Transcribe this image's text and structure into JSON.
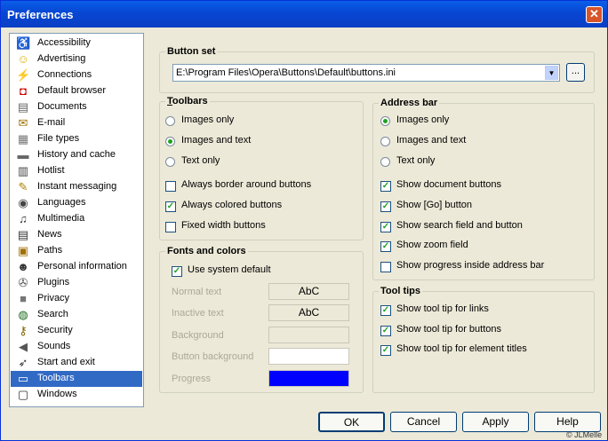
{
  "window": {
    "title": "Preferences",
    "close_glyph": "✕"
  },
  "categories": [
    {
      "label": "Accessibility",
      "icon": "accessibility-icon"
    },
    {
      "label": "Advertising",
      "icon": "smiley-icon"
    },
    {
      "label": "Connections",
      "icon": "plug-icon"
    },
    {
      "label": "Default browser",
      "icon": "default-browser-icon"
    },
    {
      "label": "Documents",
      "icon": "document-icon"
    },
    {
      "label": "E-mail",
      "icon": "envelope-icon"
    },
    {
      "label": "File types",
      "icon": "file-types-icon"
    },
    {
      "label": "History and cache",
      "icon": "disk-icon"
    },
    {
      "label": "Hotlist",
      "icon": "hotlist-icon"
    },
    {
      "label": "Instant messaging",
      "icon": "messaging-icon"
    },
    {
      "label": "Languages",
      "icon": "languages-icon"
    },
    {
      "label": "Multimedia",
      "icon": "multimedia-icon"
    },
    {
      "label": "News",
      "icon": "news-icon"
    },
    {
      "label": "Paths",
      "icon": "paths-icon"
    },
    {
      "label": "Personal information",
      "icon": "person-icon"
    },
    {
      "label": "Plugins",
      "icon": "plugins-icon"
    },
    {
      "label": "Privacy",
      "icon": "privacy-icon"
    },
    {
      "label": "Search",
      "icon": "search-icon"
    },
    {
      "label": "Security",
      "icon": "keys-icon"
    },
    {
      "label": "Sounds",
      "icon": "speaker-icon"
    },
    {
      "label": "Start and exit",
      "icon": "start-exit-icon"
    },
    {
      "label": "Toolbars",
      "icon": "toolbar-icon",
      "selected": true
    },
    {
      "label": "Windows",
      "icon": "windows-icon"
    }
  ],
  "button_set": {
    "title": "Button set",
    "path": "E:\\Program Files\\Opera\\Buttons\\Default\\buttons.ini",
    "browse_label": "..."
  },
  "toolbars": {
    "title": "Toolbars",
    "images_only": "Images only",
    "images_and_text": "Images and text",
    "text_only": "Text only",
    "always_border": "Always border around buttons",
    "always_colored": "Always colored buttons",
    "fixed_width": "Fixed width buttons"
  },
  "fonts_colors": {
    "title": "Fonts and colors",
    "use_system_default": "Use system default",
    "normal_text": "Normal text",
    "inactive_text": "Inactive text",
    "background": "Background",
    "button_background": "Button background",
    "progress": "Progress",
    "sample": "AbC",
    "progress_color": "#0000ff"
  },
  "address_bar": {
    "title": "Address bar",
    "images_only": "Images only",
    "images_and_text": "Images and text",
    "text_only": "Text only",
    "show_document_buttons": "Show document buttons",
    "show_go_button": "Show [Go] button",
    "show_search_field": "Show search field and button",
    "show_zoom_field": "Show zoom field",
    "show_progress": "Show progress inside address bar"
  },
  "tool_tips": {
    "title": "Tool tips",
    "links": "Show tool tip for links",
    "buttons": "Show tool tip for buttons",
    "element_titles": "Show tool tip for element titles"
  },
  "dialog_buttons": {
    "ok": "OK",
    "cancel": "Cancel",
    "apply": "Apply",
    "help": "Help"
  },
  "copyright": "© JLMelle",
  "checkmark": "✓"
}
